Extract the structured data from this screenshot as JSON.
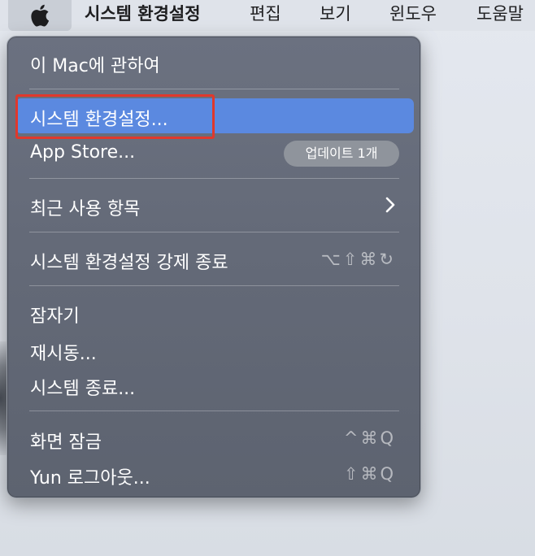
{
  "menubar": {
    "app_name": "시스템 환경설정",
    "items": [
      "편집",
      "보기",
      "윈도우",
      "도움말"
    ]
  },
  "apple_menu": {
    "items": [
      {
        "label": "이 Mac에 관하여"
      },
      {
        "label": "시스템 환경설정...",
        "highlighted": true
      },
      {
        "label": "App Store...",
        "badge": "업데이트 1개"
      },
      {
        "label": "최근 사용 항목",
        "submenu": true
      },
      {
        "label": "시스템 환경설정 강제 종료",
        "shortcut": "⌥⇧⌘↻"
      },
      {
        "label": "잠자기"
      },
      {
        "label": "재시동..."
      },
      {
        "label": "시스템 종료..."
      },
      {
        "label": "화면 잠금",
        "shortcut": "^⌘Q"
      },
      {
        "label": "Yun 로그아웃...",
        "shortcut": "⇧⌘Q"
      }
    ]
  },
  "colors": {
    "highlight": "#5b89e0",
    "annotation_box": "#e0382c",
    "menu_bg": "#646a78"
  },
  "icons": {
    "apple": "apple-logo-icon",
    "submenu": "chevron-right-icon"
  }
}
